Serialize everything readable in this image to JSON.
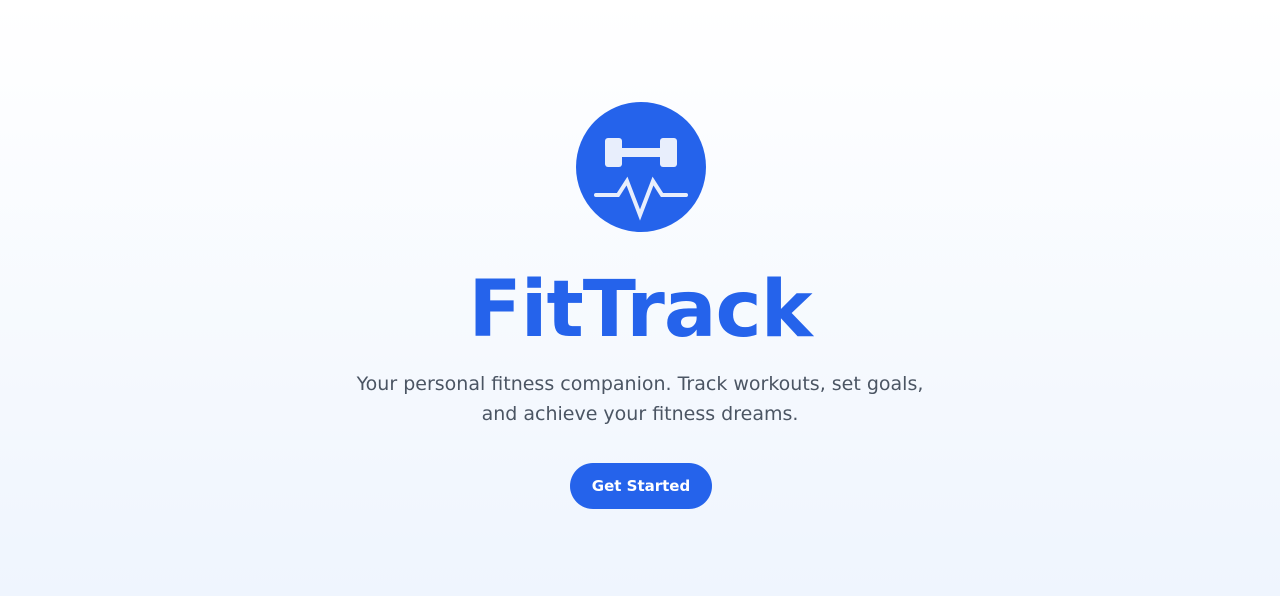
{
  "app": {
    "title": "FitTrack",
    "tagline": "Your personal fitness companion. Track workouts, set goals, and achieve your fitness dreams.",
    "logo_icon": "dumbbell-heartbeat-icon"
  },
  "cta": {
    "label": "Get Started"
  },
  "colors": {
    "brand": "#2563eb",
    "text_secondary": "#4b5563",
    "background_top": "#ffffff",
    "background_bottom": "#eff5fe"
  }
}
